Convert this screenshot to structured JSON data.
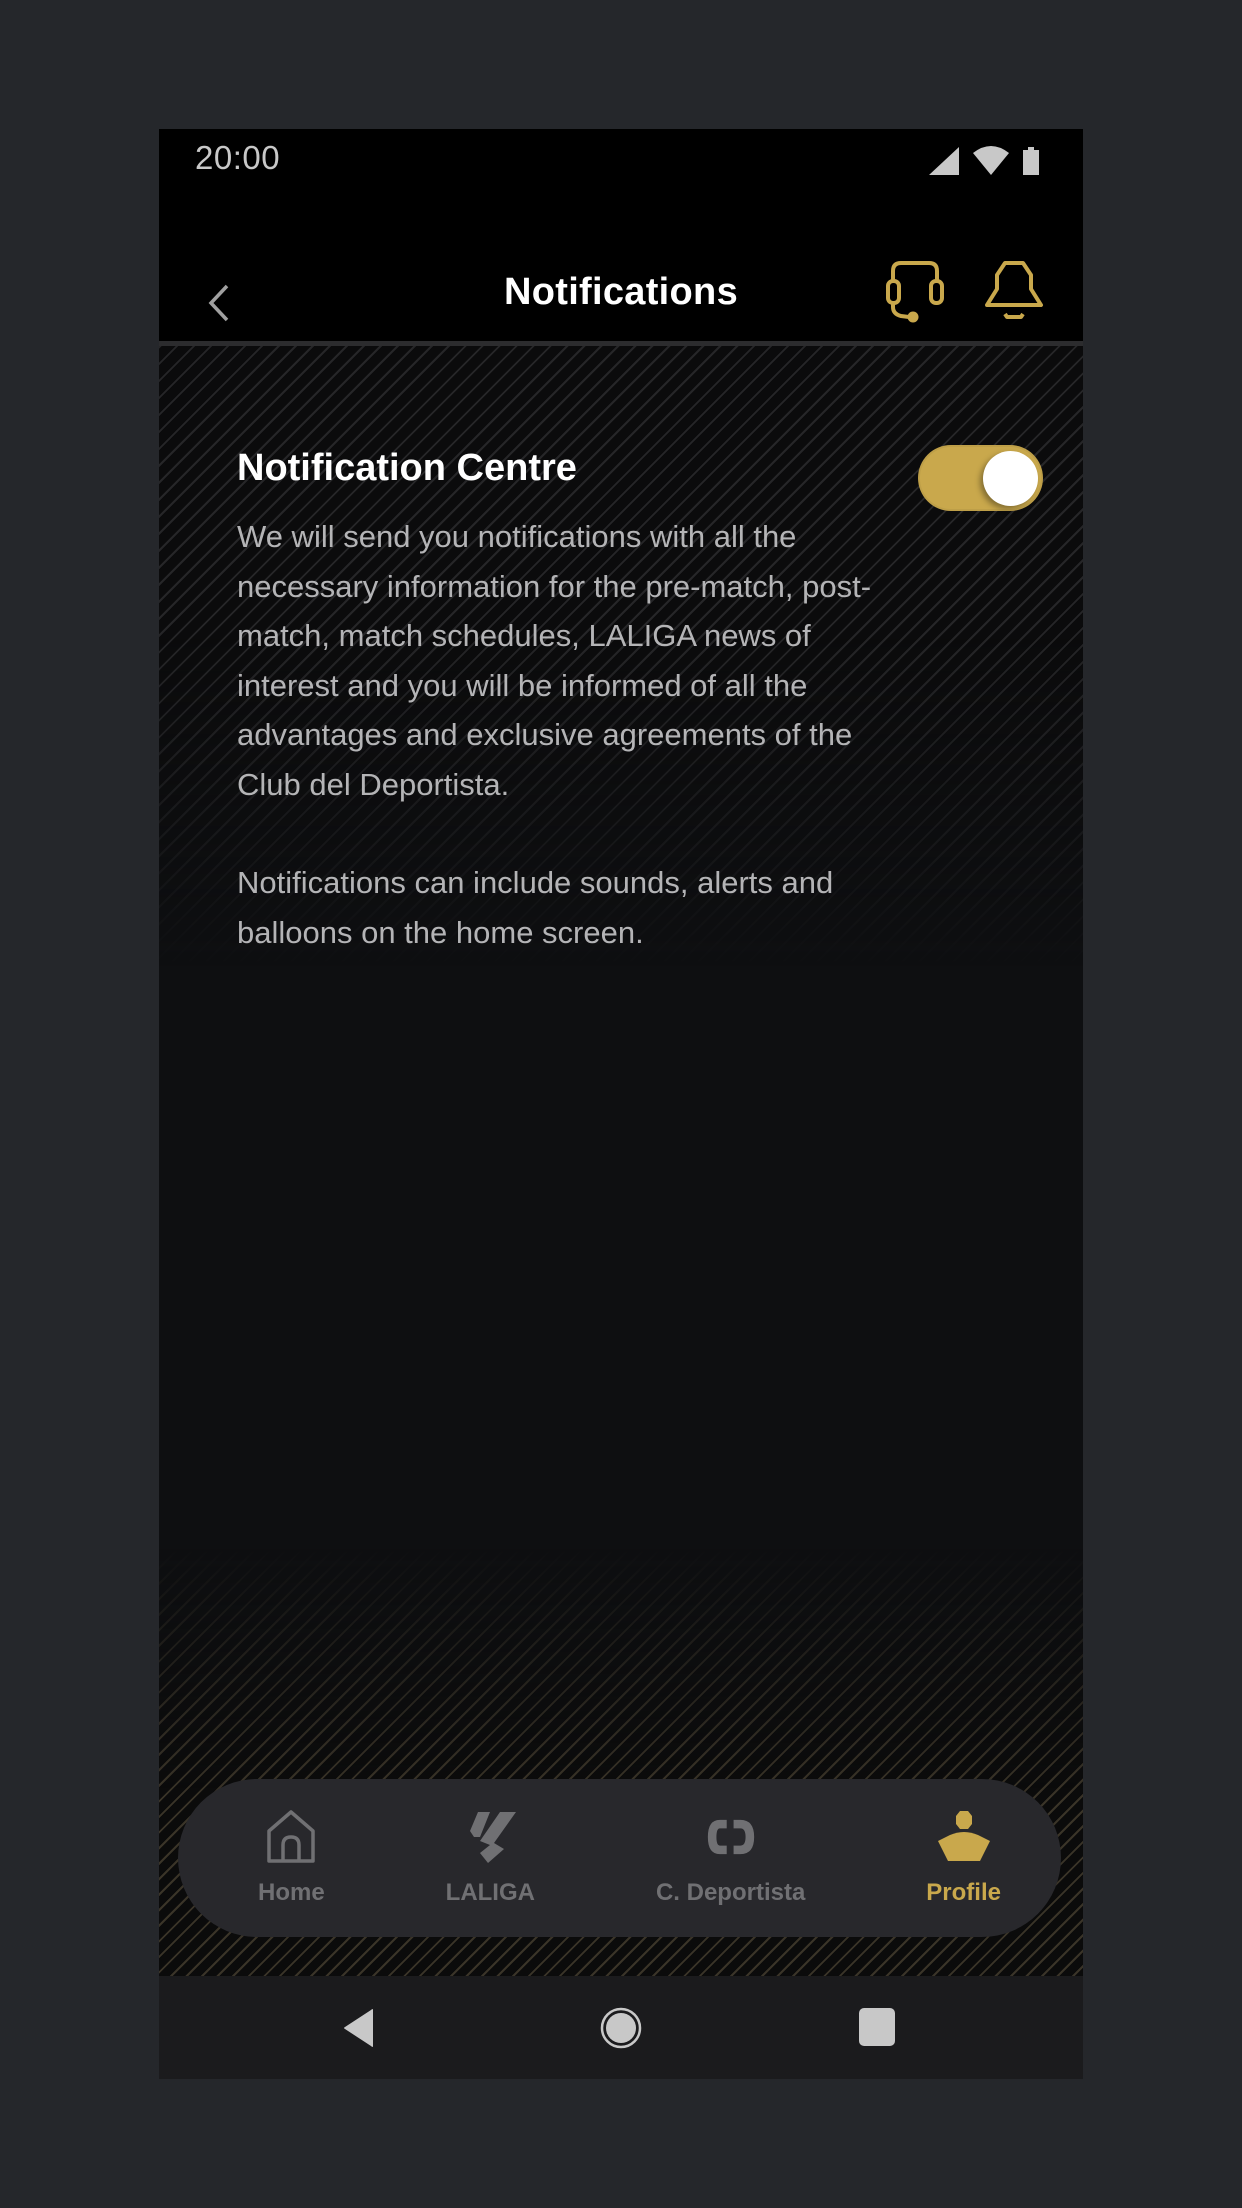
{
  "status_bar": {
    "time": "20:00",
    "icons": [
      "signal-icon",
      "wifi-icon",
      "battery-icon"
    ]
  },
  "app_bar": {
    "title": "Notifications",
    "back_icon": "chevron-left-icon",
    "actions": [
      {
        "name": "support",
        "icon": "headset-icon"
      },
      {
        "name": "notifications",
        "icon": "bell-icon"
      }
    ]
  },
  "notification_centre": {
    "title": "Notification Centre",
    "toggle_enabled": true,
    "description": "We will send you notifications with all the necessary information for the pre-match, post-match, match schedules, LALIGA news of interest and you will be informed of all the advantages and exclusive agreements of the Club del Deportista.",
    "note": "Notifications can include sounds, alerts and balloons on the home screen."
  },
  "tab_bar": {
    "active": "Profile",
    "items": [
      {
        "label": "Home",
        "icon": "home-icon"
      },
      {
        "label": "LALIGA",
        "icon": "laliga-logo-icon"
      },
      {
        "label": "C. Deportista",
        "icon": "club-deportista-icon"
      },
      {
        "label": "Profile",
        "icon": "profile-icon"
      }
    ]
  },
  "system_nav": {
    "buttons": [
      "back-triangle-icon",
      "home-circle-icon",
      "recents-square-icon"
    ]
  },
  "colors": {
    "accent": "#c9a84c",
    "background": "#0e0f11",
    "appbar": "#000000",
    "text_primary": "#ffffff",
    "text_secondary": "#b4b4b6",
    "tab_inactive": "#707073",
    "tab_bar": "#28282c"
  }
}
